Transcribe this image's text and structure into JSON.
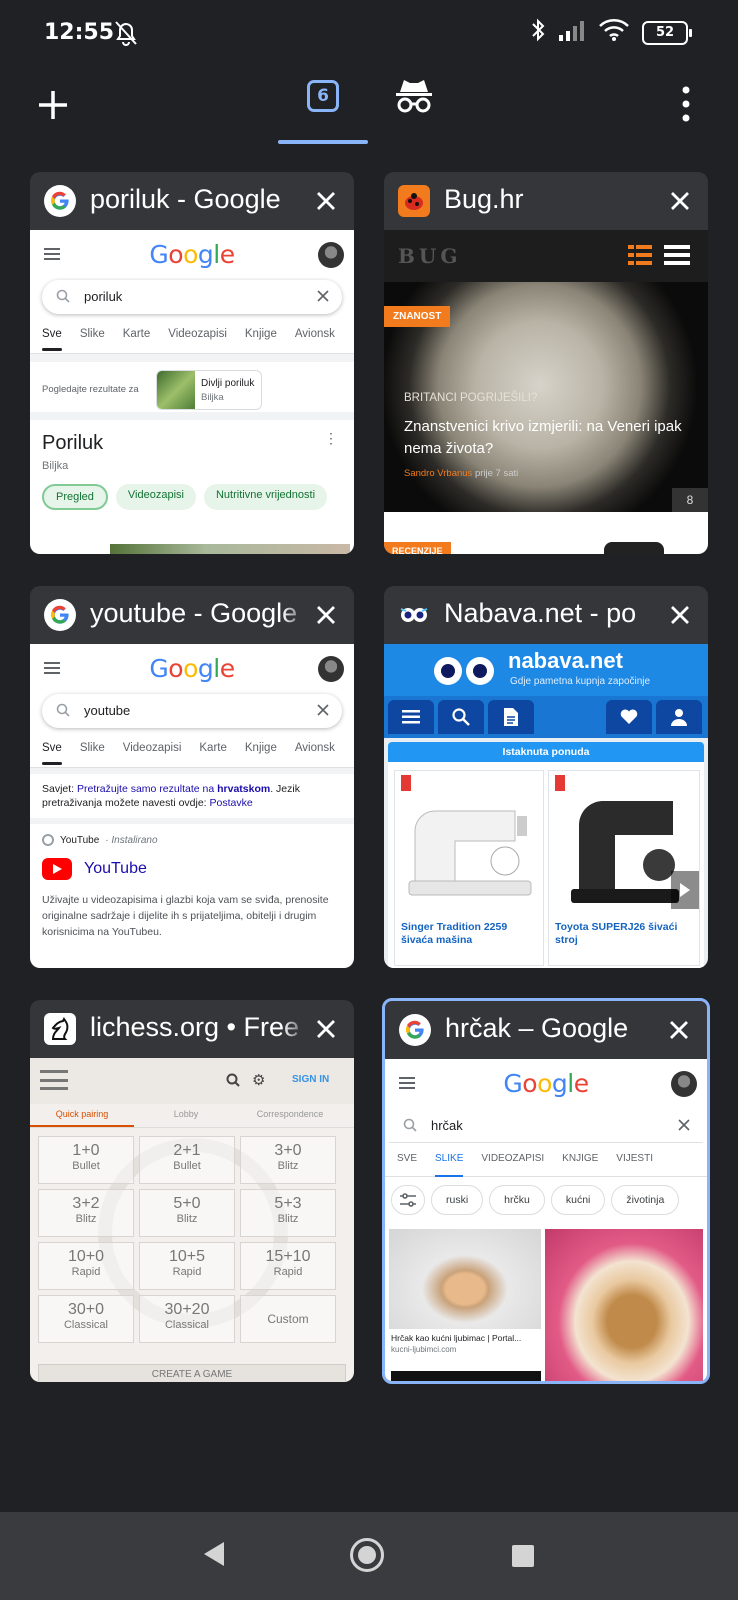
{
  "status_bar": {
    "time": "12:55",
    "battery": "52"
  },
  "toolbar": {
    "tab_count": "6"
  },
  "tabs": [
    {
      "title": "poriluk - Google",
      "favicon": "google-icon",
      "thumb": {
        "query": "poriluk",
        "nav": [
          "Sve",
          "Slike",
          "Karte",
          "Videozapisi",
          "Knjige",
          "Avionsk"
        ],
        "refine_text": "Pogledajte rezultate za",
        "refine_chip_title": "Divlji poriluk",
        "refine_chip_sub": "Biljka",
        "entity_title": "Poriluk",
        "entity_sub": "Biljka",
        "chips": [
          "Pregled",
          "Videozapisi",
          "Nutritivne vrijednosti"
        ]
      }
    },
    {
      "title": "Bug.hr",
      "favicon": "bug-icon",
      "thumb": {
        "logo": "BUG",
        "badge": "ZNANOST",
        "kicker": "BRITANCI POGRIJEŠILI?",
        "headline": "Znanstvenici krivo izmjerili: na Veneri ipak nema života?",
        "author": "Sandro Vrbanus",
        "time_ago": "prije 7 sati",
        "comments": "8",
        "next_badge": "RECENZIJE"
      }
    },
    {
      "title": "youtube - Google",
      "favicon": "google-icon",
      "thumb": {
        "query": "youtube",
        "nav": [
          "Sve",
          "Slike",
          "Videozapisi",
          "Karte",
          "Knjige",
          "Avionsk"
        ],
        "tip_prefix": "Savjet: ",
        "tip_link1": "Pretražujte samo rezultate na ",
        "tip_bold": "hrvatskom",
        "tip_mid": ". Jezik pretraživanja možete navesti ovdje: ",
        "tip_link2": "Postavke",
        "source": "YouTube",
        "source_note": "· Instalirano",
        "result_title": "YouTube",
        "snippet": "Uživajte u videozapisima i glazbi koja vam se sviđa, prenosite originalne sadržaje i dijelite ih s prijateljima, obitelji i drugim korisnicima na YouTubeu."
      }
    },
    {
      "title": "Nabava.net - po",
      "favicon": "owl-icon",
      "thumb": {
        "logo": "nabava.net",
        "tagline": "Gdje pametna kupnja započinje",
        "section": "Istaknuta ponuda",
        "products": [
          "Singer Tradition 2259 šivaća mašina",
          "Toyota SUPERJ26 šivaći stroj"
        ]
      }
    },
    {
      "title": "lichess.org • Free",
      "favicon": "lichess-icon",
      "thumb": {
        "sign_in": "SIGN IN",
        "tabs": [
          "Quick pairing",
          "Lobby",
          "Correspondence"
        ],
        "pairings": [
          {
            "time": "1+0",
            "type": "Bullet"
          },
          {
            "time": "2+1",
            "type": "Bullet"
          },
          {
            "time": "3+0",
            "type": "Blitz"
          },
          {
            "time": "3+2",
            "type": "Blitz"
          },
          {
            "time": "5+0",
            "type": "Blitz"
          },
          {
            "time": "5+3",
            "type": "Blitz"
          },
          {
            "time": "10+0",
            "type": "Rapid"
          },
          {
            "time": "10+5",
            "type": "Rapid"
          },
          {
            "time": "15+10",
            "type": "Rapid"
          },
          {
            "time": "30+0",
            "type": "Classical"
          },
          {
            "time": "30+20",
            "type": "Classical"
          },
          {
            "time": "",
            "type": "Custom"
          }
        ],
        "create": "CREATE A GAME"
      }
    },
    {
      "title": "hrčak – Google",
      "favicon": "google-icon",
      "thumb": {
        "query": "hrčak",
        "nav": [
          "SVE",
          "SLIKE",
          "VIDEOZAPISI",
          "KNJIGE",
          "VIJESTI"
        ],
        "chips": [
          "ruski",
          "hrčku",
          "kućni",
          "životinja"
        ],
        "img_caption": "Hrčak kao kućni ljubimac | Portal...",
        "img_source": "kucni-ljubimci.com"
      }
    }
  ]
}
